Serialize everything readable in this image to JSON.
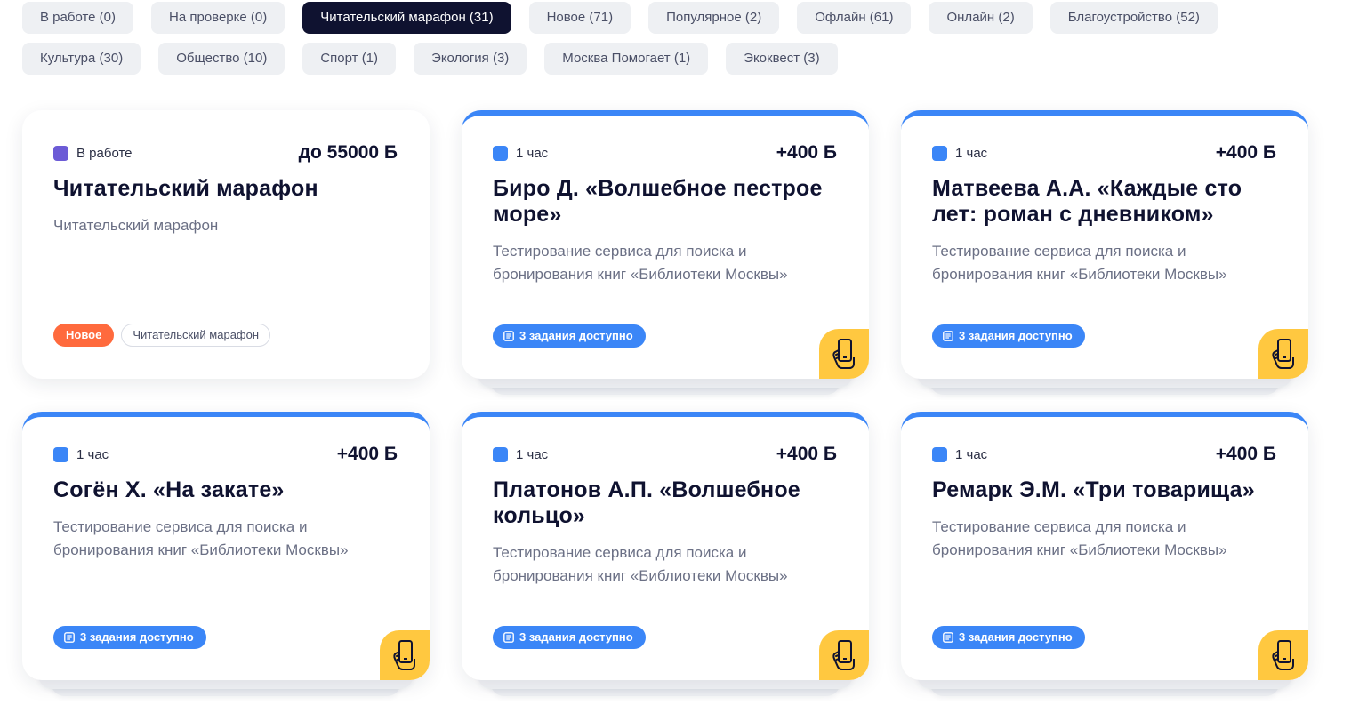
{
  "filters": {
    "row1": [
      {
        "label": "В работе (0)",
        "active": false
      },
      {
        "label": "На проверке (0)",
        "active": false
      },
      {
        "label": "Читательский марафон (31)",
        "active": true
      },
      {
        "label": "Новое (71)",
        "active": false
      },
      {
        "label": "Популярное (2)",
        "active": false
      },
      {
        "label": "Офлайн (61)",
        "active": false
      },
      {
        "label": "Онлайн (2)",
        "active": false
      },
      {
        "label": "Благоустройство (52)",
        "active": false
      }
    ],
    "row2": [
      {
        "label": "Культура (30)",
        "active": false
      },
      {
        "label": "Общество (10)",
        "active": false
      },
      {
        "label": "Спорт (1)",
        "active": false
      },
      {
        "label": "Экология (3)",
        "active": false
      },
      {
        "label": "Москва Помогает (1)",
        "active": false
      },
      {
        "label": "Экоквест (3)",
        "active": false
      }
    ]
  },
  "colors": {
    "accent_blue": "#3b86f7",
    "status_purple": "#6c5bd6",
    "new_orange": "#ff6a3d",
    "corner_yellow": "#ffc840",
    "dark": "#0f1230"
  },
  "cards": [
    {
      "status": "В работе",
      "status_icon": "purple-square-icon",
      "points": "до 55000 Б",
      "title": "Читательский марафон",
      "description": "Читательский марафон",
      "badge_new": "Новое",
      "badge_tag": "Читательский марафон"
    },
    {
      "status": "1 час",
      "status_icon": "blue-square-icon",
      "points": "+400 Б",
      "title": "Биро Д. «Волшебное пестрое море»",
      "description": "Тестирование сервиса для поиска и бронирования книг «Библиотеки Москвы»",
      "tasks": "3 задания доступно",
      "corner_icon": "phone-in-hand-icon"
    },
    {
      "status": "1 час",
      "status_icon": "blue-square-icon",
      "points": "+400 Б",
      "title": "Матвеева А.А. «Каждые сто лет: роман с дневником»",
      "description": "Тестирование сервиса для поиска и бронирования книг «Библиотеки Москвы»",
      "tasks": "3 задания доступно",
      "corner_icon": "phone-in-hand-icon"
    },
    {
      "status": "1 час",
      "status_icon": "blue-square-icon",
      "points": "+400 Б",
      "title": "Согён Х. «На закате»",
      "description": "Тестирование сервиса для поиска и бронирования книг «Библиотеки Москвы»",
      "tasks": "3 задания доступно",
      "corner_icon": "phone-in-hand-icon"
    },
    {
      "status": "1 час",
      "status_icon": "blue-square-icon",
      "points": "+400 Б",
      "title": "Платонов А.П. «Волшебное кольцо»",
      "description": "Тестирование сервиса для поиска и бронирования книг «Библиотеки Москвы»",
      "tasks": "3 задания доступно",
      "corner_icon": "phone-in-hand-icon"
    },
    {
      "status": "1 час",
      "status_icon": "blue-square-icon",
      "points": "+400 Б",
      "title": "Ремарк Э.М. «Три товарища»",
      "description": "Тестирование сервиса для поиска и бронирования книг «Библиотеки Москвы»",
      "tasks": "3 задания доступно",
      "corner_icon": "phone-in-hand-icon"
    }
  ]
}
